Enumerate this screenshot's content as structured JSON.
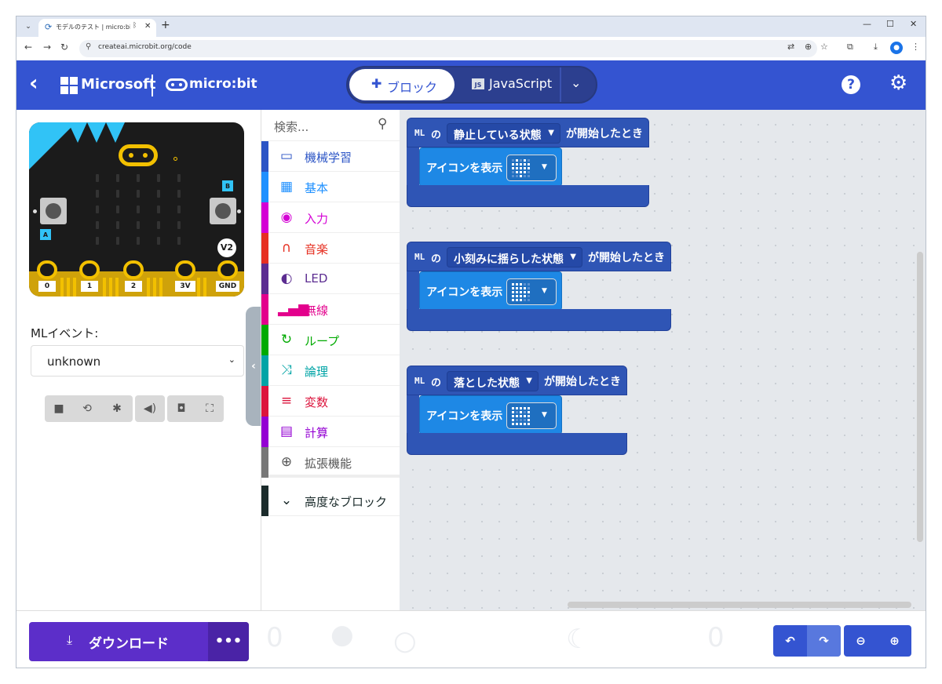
{
  "browser": {
    "tab_title": "モデルのテスト | micro:bit Crea",
    "url": "createai.microbit.org/code",
    "tab_menu": "⌄",
    "bluetooth": "ᛒ",
    "close": "✕",
    "new_tab": "+",
    "minimize": "—",
    "maximize": "☐",
    "win_close": "✕"
  },
  "header": {
    "brand_ms": "Microsoft",
    "brand_mb": "micro:bit",
    "mode_blocks": "ブロック",
    "mode_js": "JavaScript",
    "js_badge": "JS",
    "help": "?"
  },
  "simulator": {
    "pins": [
      "0",
      "1",
      "2",
      "3V",
      "GND"
    ],
    "button_a": "A",
    "button_b": "B",
    "version_badge": "V2",
    "ml_event_label": "MLイベント:",
    "ml_event_value": "unknown"
  },
  "toolbox": {
    "search_placeholder": "検索...",
    "categories": [
      {
        "label": "機械学習",
        "color": "#2b54c5",
        "icon": "monitor-icon"
      },
      {
        "label": "基本",
        "color": "#1e90ff",
        "icon": "grid-icon"
      },
      {
        "label": "入力",
        "color": "#d400d4",
        "icon": "target-icon"
      },
      {
        "label": "音楽",
        "color": "#e63022",
        "icon": "headphones-icon"
      },
      {
        "label": "LED",
        "color": "#5c2d91",
        "icon": "toggle-icon"
      },
      {
        "label": "無線",
        "color": "#e3008c",
        "icon": "signal-icon"
      },
      {
        "label": "ループ",
        "color": "#00aa00",
        "icon": "loop-icon"
      },
      {
        "label": "論理",
        "color": "#00a4a6",
        "icon": "shuffle-icon"
      },
      {
        "label": "変数",
        "color": "#dc143c",
        "icon": "list-icon"
      },
      {
        "label": "計算",
        "color": "#9400d3",
        "icon": "calculator-icon"
      },
      {
        "label": "拡張機能",
        "color": "#777777",
        "icon": "plus-circle-icon"
      },
      {
        "label": "高度なブロック",
        "color": "#1b2b2b",
        "icon": "chevron-down-icon"
      }
    ]
  },
  "workspace": {
    "blocks": [
      {
        "ml": "ML",
        "of": "の",
        "state": "静止している状態",
        "trigger": "が開始したとき",
        "action": "アイコンを表示"
      },
      {
        "ml": "ML",
        "of": "の",
        "state": "小刻みに揺らした状態",
        "trigger": "が開始したとき",
        "action": "アイコンを表示"
      },
      {
        "ml": "ML",
        "of": "の",
        "state": "落とした状態",
        "trigger": "が開始したとき",
        "action": "アイコンを表示"
      }
    ]
  },
  "footer": {
    "download": "ダウンロード",
    "more": "•••"
  }
}
